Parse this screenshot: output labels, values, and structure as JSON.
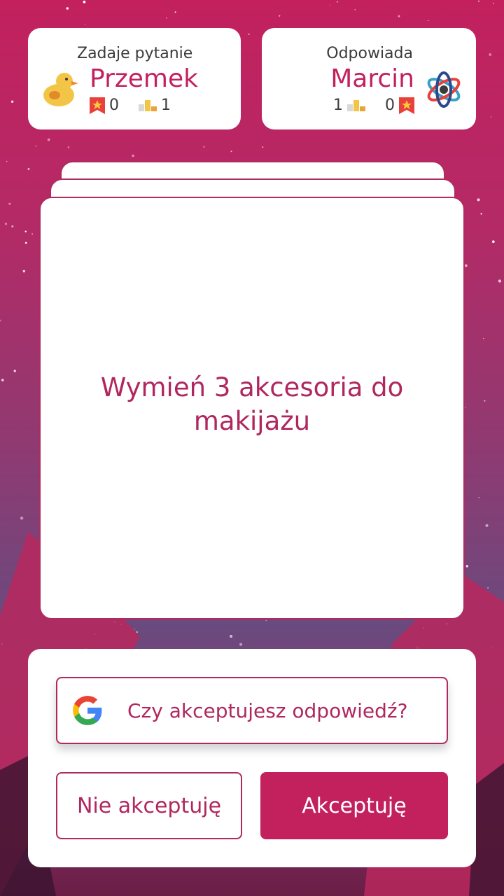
{
  "asker": {
    "role_label": "Zadaje pytanie",
    "name": "Przemek",
    "stars": "0",
    "trophies": "1",
    "avatar_icon": "duck-icon"
  },
  "answerer": {
    "role_label": "Odpowiada",
    "name": "Marcin",
    "trophies": "1",
    "stars": "0",
    "avatar_icon": "atom-icon"
  },
  "question": {
    "text": "Wymień 3 akcesoria do makijażu"
  },
  "actions": {
    "google_prompt": "Czy akceptujesz odpowiedź?",
    "decline_label": "Nie akceptuję",
    "accept_label": "Akceptuję"
  },
  "colors": {
    "accent": "#c2215e",
    "text_dark": "#3b3b3b"
  }
}
